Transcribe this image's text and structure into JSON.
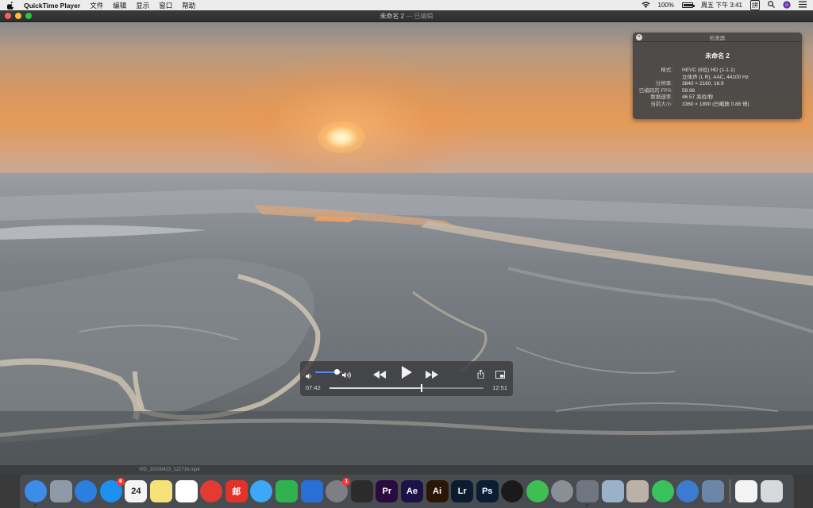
{
  "menubar": {
    "app_name": "QuickTime Player",
    "menus": [
      "文件",
      "编辑",
      "显示",
      "窗口",
      "帮助"
    ],
    "battery_text": "100%",
    "battery_level": 1.0,
    "clock": "周五 下午 3:41",
    "input_method": "拼"
  },
  "window": {
    "title": "未命名 2",
    "title_suffix": "— 已编辑"
  },
  "inspector": {
    "header": "检查器",
    "name": "未命名 2",
    "rows": [
      {
        "key": "格式:",
        "value": "HEVC (8位) HD (1-1-1)"
      },
      {
        "key": "",
        "value": "立体声 (L R), AAC, 44100 Hz"
      },
      {
        "key": "分辨率:",
        "value": "3840 × 2160, 16:9"
      },
      {
        "key": "已编码的 FPS:",
        "value": "59.96"
      },
      {
        "key": "数据速率:",
        "value": "46.57 兆位/秒"
      },
      {
        "key": "当前大小:",
        "value": "3360 × 1890 (已缩放 0.88 倍)"
      }
    ]
  },
  "player": {
    "current_time": "07:42",
    "duration": "12:51",
    "progress": 0.599,
    "volume": 0.82
  },
  "dock_strip_text": "VID_20200423_122716.mp4",
  "dock": {
    "icons": [
      {
        "name": "finder-icon",
        "label": "",
        "color": "#3b8de8",
        "running": true
      },
      {
        "name": "launchpad-icon",
        "label": "",
        "color": "#8e9aa8"
      },
      {
        "name": "safari-icon",
        "label": "",
        "color": "#2d7fdf"
      },
      {
        "name": "app-store-icon",
        "label": "",
        "color": "#1d8ff0",
        "badge": "8"
      },
      {
        "name": "calendar-icon",
        "label": "24",
        "color": "#f4f4f4"
      },
      {
        "name": "notes-icon",
        "label": "",
        "color": "#f7e27a"
      },
      {
        "name": "baidu-netdisk-icon",
        "label": "",
        "color": "#ffffff"
      },
      {
        "name": "netease-music-icon",
        "label": "",
        "color": "#e33a32"
      },
      {
        "name": "mail-app-icon",
        "label": "邮",
        "color": "#e4322b"
      },
      {
        "name": "messages-icon",
        "label": "",
        "color": "#3da8f5"
      },
      {
        "name": "numbers-icon",
        "label": "",
        "color": "#2fb24f"
      },
      {
        "name": "keynote-icon",
        "label": "",
        "color": "#2a6fd6"
      },
      {
        "name": "system-preferences-icon",
        "label": "",
        "color": "#7c7f84",
        "badge": "1"
      },
      {
        "name": "final-cut-pro-icon",
        "label": "",
        "color": "#2b2b2b"
      },
      {
        "name": "premiere-pro-icon",
        "label": "Pr",
        "color": "#2a0a3f"
      },
      {
        "name": "after-effects-icon",
        "label": "Ae",
        "color": "#1c1247"
      },
      {
        "name": "illustrator-icon",
        "label": "Ai",
        "color": "#2b1605"
      },
      {
        "name": "lightroom-icon",
        "label": "Lr",
        "color": "#0c1b2e"
      },
      {
        "name": "photoshop-icon",
        "label": "Ps",
        "color": "#0b1d33"
      },
      {
        "name": "qq-icon",
        "label": "",
        "color": "#1a1a1a"
      },
      {
        "name": "wechat-icon",
        "label": "",
        "color": "#3fbf52"
      },
      {
        "name": "disk-utility-icon",
        "label": "",
        "color": "#8a8f96"
      },
      {
        "name": "quicktime-icon",
        "label": "",
        "color": "#6f7680",
        "running": true
      },
      {
        "name": "preview-icon",
        "label": "",
        "color": "#9ab2c9"
      },
      {
        "name": "archive-utility-icon",
        "label": "",
        "color": "#b9b2a5"
      },
      {
        "name": "iqiyi-icon",
        "label": "",
        "color": "#38c25c"
      },
      {
        "name": "quick-look-icon",
        "label": "",
        "color": "#3b7bd0"
      },
      {
        "name": "image-capture-icon",
        "label": "",
        "color": "#6b86a8"
      },
      {
        "name": "document-icon",
        "label": "",
        "color": "#f3f3f3"
      },
      {
        "name": "trash-icon",
        "label": "",
        "color": "#d7dadd"
      }
    ]
  }
}
